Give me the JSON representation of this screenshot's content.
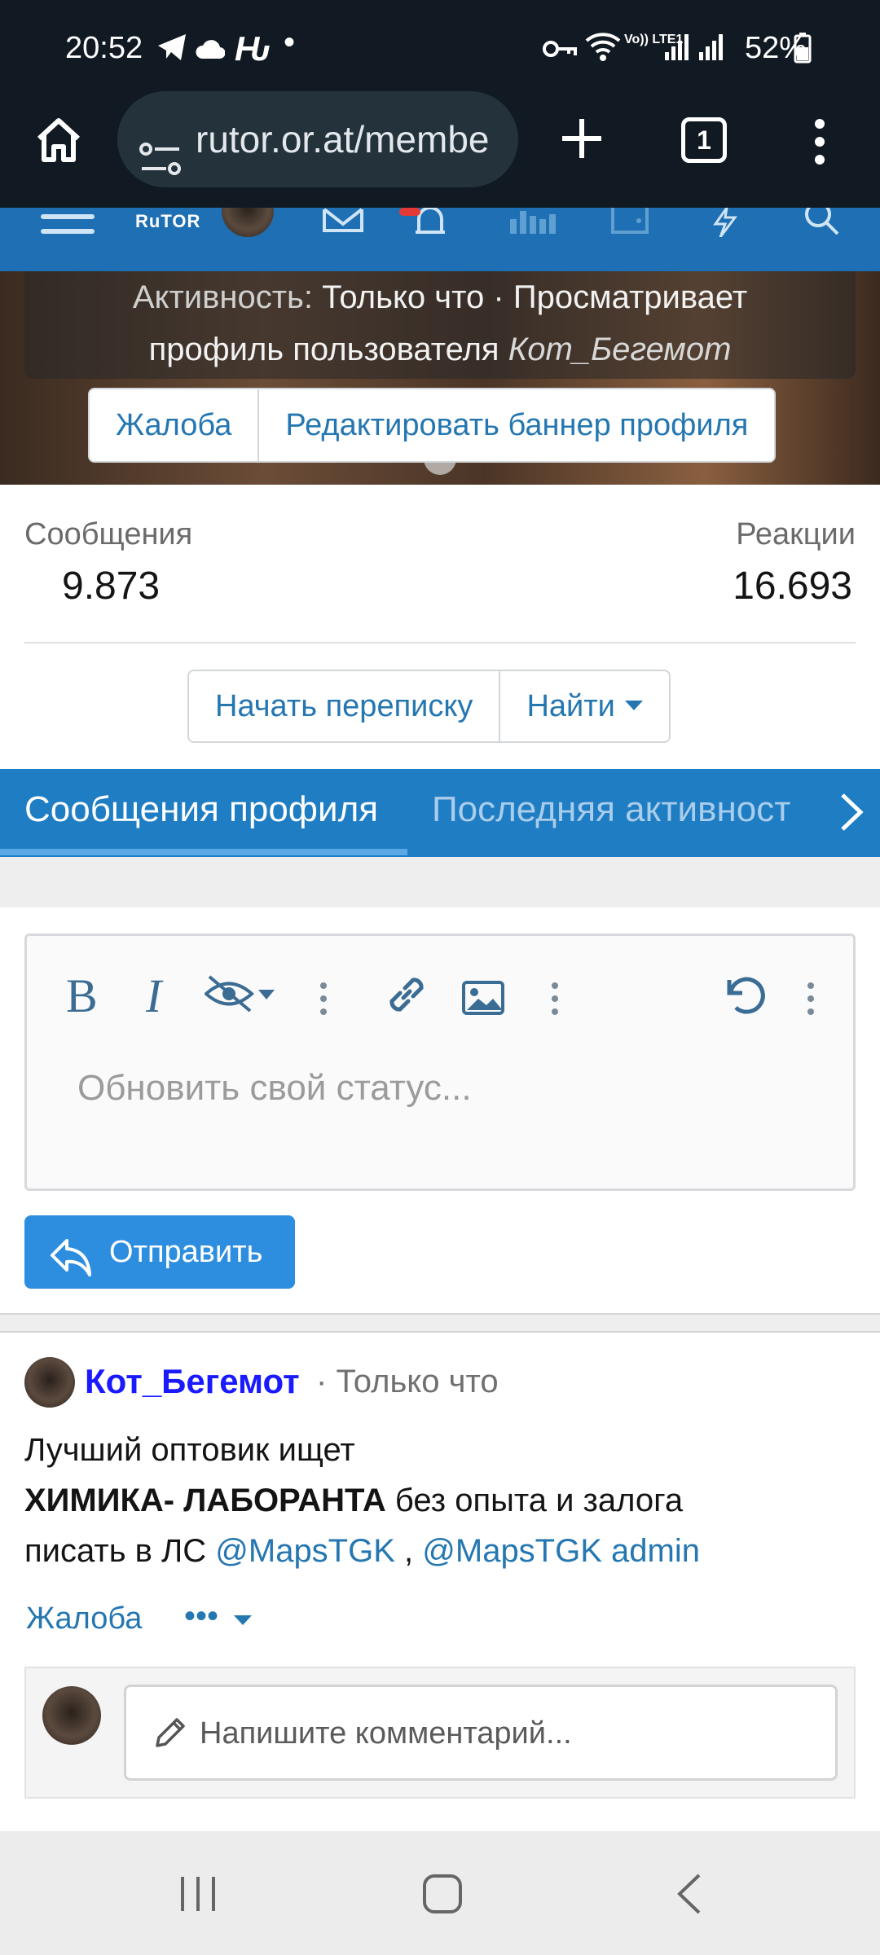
{
  "status_bar": {
    "time": "20:52",
    "battery": "52%",
    "icons": [
      "telegram-icon",
      "cloud-icon",
      "hn-icon",
      "dot-icon",
      "key-icon",
      "wifi-icon",
      "volte-icon",
      "signal-icon",
      "signal-icon",
      "battery-icon"
    ],
    "volte_label": "Vo)) LTE1"
  },
  "browser": {
    "url": "rutor.or.at/membe",
    "tab_count": "1"
  },
  "site_header": {
    "logo": "RuTOR",
    "icons": [
      "menu-icon",
      "avatar",
      "mail-icon",
      "bell-icon",
      "stats-icon",
      "wallet-icon",
      "lightning-icon",
      "search-icon"
    ]
  },
  "banner": {
    "activity_label": "Активность:",
    "activity_value": "Только что",
    "activity_sep": "·",
    "activity_action": "Просматривает профиль пользователя",
    "activity_user": "Кот_Бегемот",
    "report_label": "Жалоба",
    "edit_banner_label": "Редактировать баннер профиля"
  },
  "stats": {
    "messages_label": "Сообщения",
    "messages_value": "9.873",
    "reactions_label": "Реакции",
    "reactions_value": "16.693"
  },
  "actions": {
    "start_conversation": "Начать переписку",
    "find": "Найти"
  },
  "tabs": [
    {
      "label": "Сообщения профиля",
      "active": true
    },
    {
      "label": "Последняя активност",
      "active": false
    }
  ],
  "editor": {
    "placeholder": "Обновить свой статус...",
    "toolbar": [
      "bold-icon",
      "italic-icon",
      "hide-icon",
      "more-icon",
      "link-icon",
      "image-icon",
      "more-icon",
      "undo-icon",
      "more-icon"
    ],
    "bold": "B",
    "italic": "I",
    "send_label": "Отправить"
  },
  "post": {
    "author": "Кот_Бегемот",
    "sep": "·",
    "time": "Только что",
    "line1": "Лучший оптовик ищет",
    "line2_bold": "ХИМИКА- ЛАБОРАНТА",
    "line2_rest": " без опыта и залога",
    "line3_prefix": "писать в ЛС ",
    "mention1": "@MapsTGK",
    "line3_comma": " , ",
    "mention2": "@MapsTGK admin",
    "report": "Жалоба",
    "more": "•••",
    "comment_placeholder": "Напишите комментарий..."
  }
}
